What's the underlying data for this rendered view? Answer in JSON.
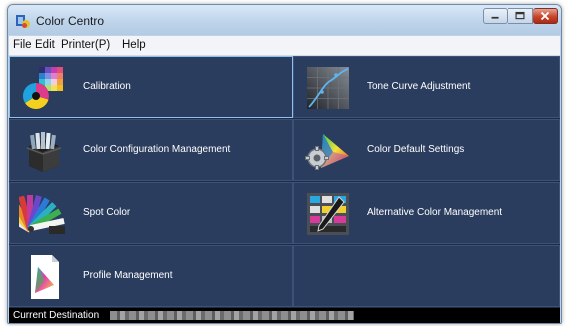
{
  "window": {
    "title": "Color Centro"
  },
  "menu": {
    "file": "File",
    "edit": "Edit",
    "printer": "Printer(P)",
    "help": "Help"
  },
  "tiles": [
    {
      "label": "Calibration",
      "icon": "calibration-icon"
    },
    {
      "label": "Tone Curve Adjustment",
      "icon": "tone-curve-icon"
    },
    {
      "label": "Color Configuration Management",
      "icon": "color-configuration-icon"
    },
    {
      "label": "Color Default Settings",
      "icon": "color-default-settings-icon"
    },
    {
      "label": "Spot Color",
      "icon": "spot-color-icon"
    },
    {
      "label": "Alternative Color Management",
      "icon": "alternative-color-icon"
    },
    {
      "label": "Profile Management",
      "icon": "profile-management-icon"
    }
  ],
  "status": {
    "label": "Current Destination"
  },
  "colors": {
    "background": "#1b2c49",
    "tile": "#2b3d5f",
    "selected_border": "#8dc2ee"
  }
}
